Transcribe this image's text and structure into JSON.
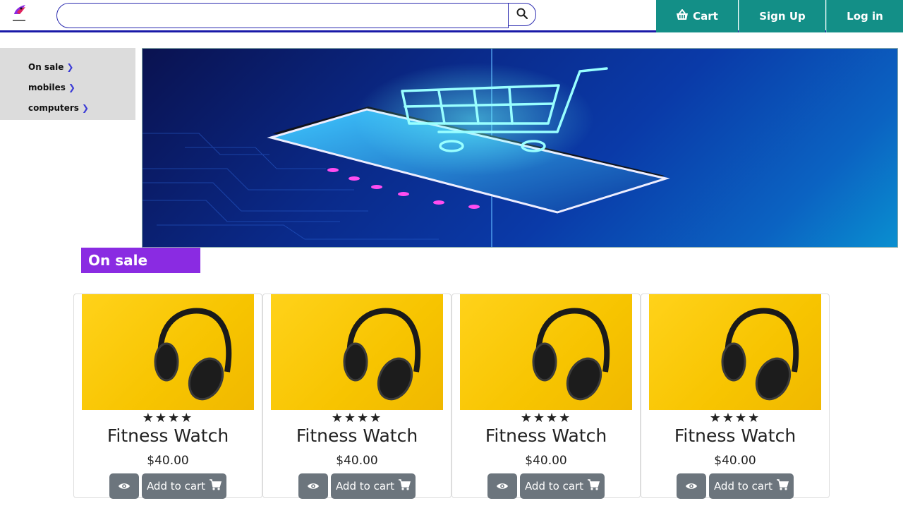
{
  "header": {
    "search": {
      "value": "",
      "placeholder": ""
    },
    "nav": {
      "cart_label": "Cart",
      "signup_label": "Sign Up",
      "login_label": "Log in"
    },
    "accent_color": "#138f87",
    "border_color": "#1a1aa8"
  },
  "sidebar": {
    "items": [
      {
        "label": "On sale"
      },
      {
        "label": "mobiles"
      },
      {
        "label": "computers"
      }
    ]
  },
  "section": {
    "title": "On sale",
    "color": "#8a2be2"
  },
  "products": [
    {
      "title": "Fitness Watch",
      "price": "$40.00",
      "rating": 4,
      "stars": "★★★★",
      "add_label": "Add to cart"
    },
    {
      "title": "Fitness Watch",
      "price": "$40.00",
      "rating": 4,
      "stars": "★★★★",
      "add_label": "Add to cart"
    },
    {
      "title": "Fitness Watch",
      "price": "$40.00",
      "rating": 4,
      "stars": "★★★★",
      "add_label": "Add to cart"
    },
    {
      "title": "Fitness Watch",
      "price": "$40.00",
      "rating": 4,
      "stars": "★★★★",
      "add_label": "Add to cart"
    }
  ],
  "icons": {
    "logo": "bird-logo-icon",
    "search": "search-icon",
    "cart": "shopping-basket-icon",
    "view": "eye-icon",
    "add": "shopping-cart-icon",
    "chevron": "chevron-right-icon"
  }
}
